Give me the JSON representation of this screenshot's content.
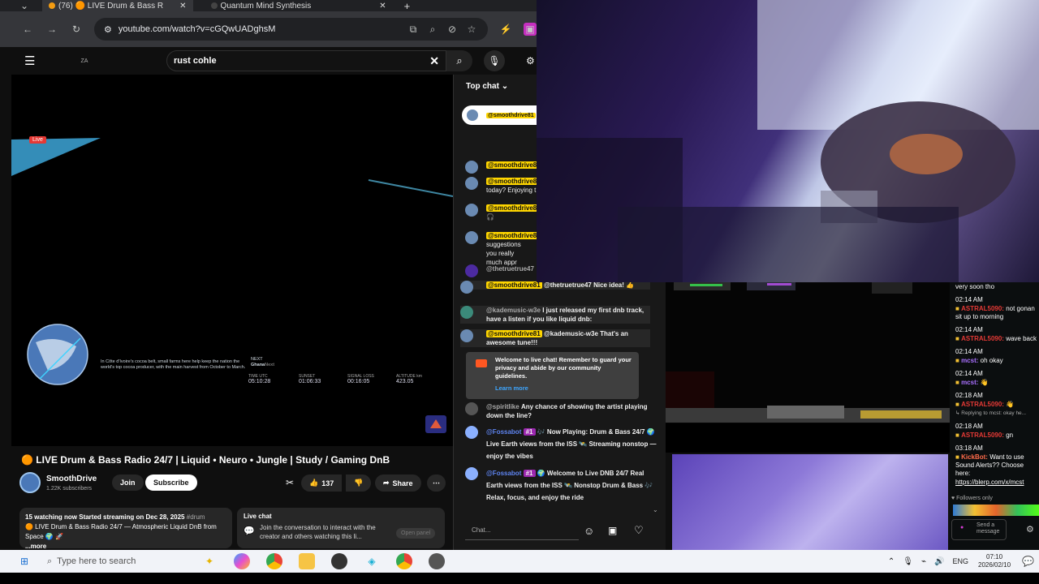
{
  "browser": {
    "tabs": [
      {
        "label": "(76) 🟠 LIVE Drum & Bass R"
      },
      {
        "label": "Quantum Mind Synthesis"
      }
    ],
    "new_tab_label": "+",
    "url": "youtube.com/watch?v=cGQwUADghsM"
  },
  "youtube": {
    "country_code": "ZA",
    "search_value": "rust cohle",
    "video": {
      "live_badge": "Live",
      "ticker_text": "In Côte d'Ivoire's cocoa belt, small farms here help keep the nation the world's top cocoa producer, with the main harvest from October to March.",
      "next_label": "NEXT",
      "next_value": "Ghana",
      "next_value_faded": "Next",
      "stat_labels": [
        "TIME UTC",
        "SUNSET",
        "SIGNAL LOSS",
        "ALTITUDE km"
      ],
      "stat_values": [
        "05:10:28",
        "01:06:33",
        "00:16:05",
        "423.05"
      ]
    },
    "title": "🟠 LIVE Drum & Bass Radio 24/7 | Liquid • Neuro • Jungle | Study / Gaming DnB",
    "channel": {
      "name": "SmoothDrive",
      "subscribers": "1.22K subscribers"
    },
    "join_label": "Join",
    "subscribe_label": "Subscribe",
    "like_count": "137",
    "share_label": "Share",
    "description": {
      "meta": "15 watching now  Started streaming on Dec 28, 2025",
      "hashtag": "#drum",
      "text": "🟠 LIVE Drum & Bass Radio 24/7 — Atmospheric Liquid DnB from Space 🌍 🚀",
      "more": "...more"
    },
    "live_chat_card": {
      "title": "Live chat",
      "text": "Join the conversation to interact with the creator and others watching this li...",
      "open_panel": "Open panel"
    }
  },
  "chat": {
    "header": "Top chat",
    "pinned_user": "@smoothdrive81",
    "messages": [
      {
        "user": "@smoothdrive81",
        "text": ""
      },
      {
        "user": "@smoothdrive81",
        "text": "today? Enjoying t"
      },
      {
        "user": "@smoothdrive81",
        "text": "🎧"
      },
      {
        "user": "@smoothdrive81",
        "text": "suggestions you really much appr"
      },
      {
        "user": "@thetruetrue47",
        "text": ""
      },
      {
        "user": "@smoothdrive81",
        "text": "@thetruetrue47 Nice idea! 👍"
      },
      {
        "user": "@kademusic-w3e",
        "text": "I just released my first dnb track, have a listen if you like liquid dnb:"
      },
      {
        "user": "@smoothdrive81",
        "text": "@kademusic-w3e That's an awesome tune!!!"
      }
    ],
    "welcome_text": "Welcome to live chat! Remember to guard your privacy and abide by our community guidelines.",
    "learn_more": "Learn more",
    "more_messages": [
      {
        "user": "@spiritlike",
        "text": "Any chance of showing the artist playing down the line?"
      },
      {
        "user": "@Fossabot",
        "badge": "#1",
        "text": "🎶 Now Playing: Drum & Bass 24/7 🌍 Live Earth views from the ISS 🛰️ Streaming nonstop — enjoy the vibes"
      },
      {
        "user": "@Fossabot",
        "badge": "#1",
        "text": "🌍 Welcome to Live DNB 24/7 Real Earth views from the ISS 🛰️ Nonstop Drum & Bass 🎶 Relax, focus, and enjoy the ride"
      }
    ],
    "input_placeholder": "Chat..."
  },
  "kick": {
    "lines": [
      {
        "type": "text",
        "text": "very soon tho"
      },
      {
        "type": "time",
        "text": "02:14 AM"
      },
      {
        "type": "msg",
        "user": "ASTRAL5090:",
        "text": "not gonan sit up to morning"
      },
      {
        "type": "time",
        "text": "02:14 AM"
      },
      {
        "type": "msg",
        "user": "ASTRAL5090:",
        "text": "wave back"
      },
      {
        "type": "time",
        "text": "02:14 AM"
      },
      {
        "type": "msg",
        "user": "mcst:",
        "text": "oh okay"
      },
      {
        "type": "time",
        "text": "02:14 AM"
      },
      {
        "type": "msg",
        "user": "mcst:",
        "text": "👋"
      },
      {
        "type": "time",
        "text": "02:18 AM"
      },
      {
        "type": "msg",
        "user": "ASTRAL5090:",
        "text": "👋"
      },
      {
        "type": "reply",
        "text": "↳ Replying to mcst: okay he..."
      },
      {
        "type": "time",
        "text": "02:18 AM"
      },
      {
        "type": "msg",
        "user": "ASTRAL5090:",
        "text": "gn"
      },
      {
        "type": "time",
        "text": "03:18 AM"
      },
      {
        "type": "msg",
        "user": "KickBot:",
        "text": "Want to use Sound Alerts?? Choose here:"
      },
      {
        "type": "link",
        "text": "https://blerp.com/x/mcst"
      }
    ],
    "followers_only": "Followers only",
    "send_label": "Send a message"
  },
  "taskbar": {
    "search_placeholder": "Type here to search",
    "lang": "ENG",
    "time": "07:10",
    "date": "2026/02/10"
  },
  "colors": {
    "accent_yellow": "#ffd600",
    "live_red": "#e53935",
    "kick_green": "#53fc18",
    "purple_user": "#a970ff"
  }
}
